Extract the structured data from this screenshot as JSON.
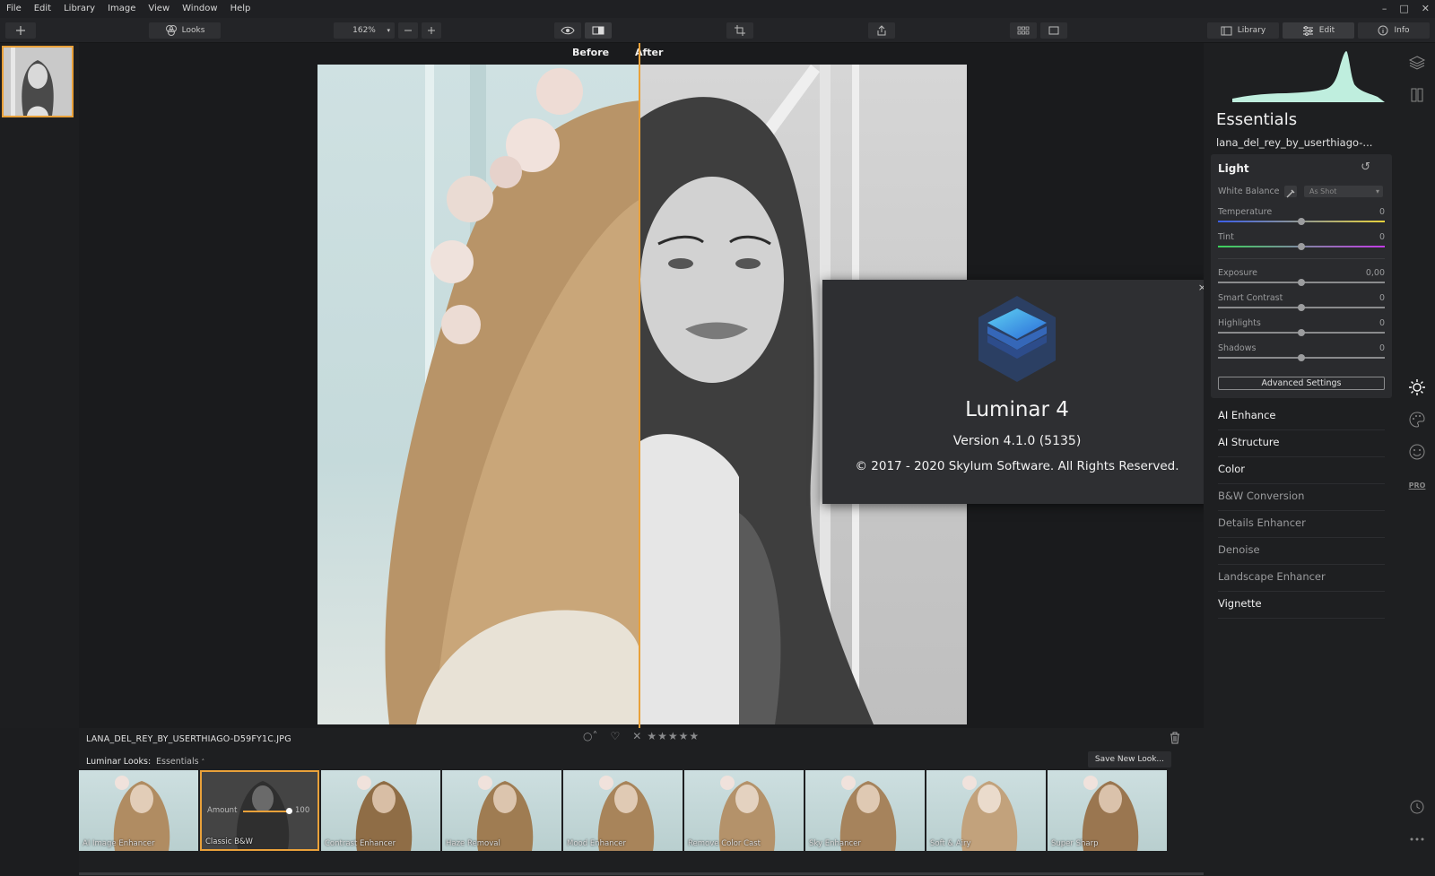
{
  "menu": [
    "File",
    "Edit",
    "Library",
    "Image",
    "View",
    "Window",
    "Help"
  ],
  "window_controls": [
    "–",
    "□",
    "✕"
  ],
  "toolbar": {
    "looks_label": "Looks",
    "zoom": "162%",
    "library_tab": "Library",
    "edit_tab": "Edit",
    "info_tab": "Info"
  },
  "canvas": {
    "before_label": "Before",
    "after_label": "After"
  },
  "about": {
    "app_name": "Luminar 4",
    "version": "Version 4.1.0 (5135)",
    "copyright": "© 2017 - 2020 Skylum Software. All Rights Reserved.",
    "close": "×"
  },
  "panel": {
    "title": "Essentials",
    "filename": "lana_del_rey_by_userthiago-...",
    "light": {
      "header": "Light",
      "white_balance_label": "White Balance",
      "white_balance_value": "As Shot",
      "sliders": [
        {
          "label": "Temperature",
          "value": "0"
        },
        {
          "label": "Tint",
          "value": "0"
        },
        {
          "label": "Exposure",
          "value": "0,00"
        },
        {
          "label": "Smart Contrast",
          "value": "0"
        },
        {
          "label": "Highlights",
          "value": "0"
        },
        {
          "label": "Shadows",
          "value": "0"
        }
      ],
      "advanced": "Advanced Settings"
    },
    "tools": [
      {
        "label": "AI Enhance",
        "active": true
      },
      {
        "label": "AI Structure",
        "active": true
      },
      {
        "label": "Color",
        "active": true
      },
      {
        "label": "B&W Conversion",
        "active": false
      },
      {
        "label": "Details Enhancer",
        "active": false
      },
      {
        "label": "Denoise",
        "active": false
      },
      {
        "label": "Landscape Enhancer",
        "active": false
      },
      {
        "label": "Vignette",
        "active": true
      }
    ],
    "pro_label": "PRO"
  },
  "bottom": {
    "filename": "LANA_DEL_REY_BY_USERTHIAGO-D59FY1C.JPG",
    "looks_label": "Luminar Looks:",
    "looks_category": "Essentials",
    "save_look": "Save New Look...",
    "amount_label": "Amount",
    "amount_value": "100",
    "looks": [
      "AI Image Enhancer",
      "Classic B&W",
      "Contrast Enhancer",
      "Haze Removal",
      "Mood Enhancer",
      "Remove Color Cast",
      "Sky Enhancer",
      "Soft & Airy",
      "Super Sharp"
    ]
  },
  "colors": {
    "accent": "#e9a13a",
    "panel": "#1e1f21",
    "dialog": "#2e2f32"
  }
}
